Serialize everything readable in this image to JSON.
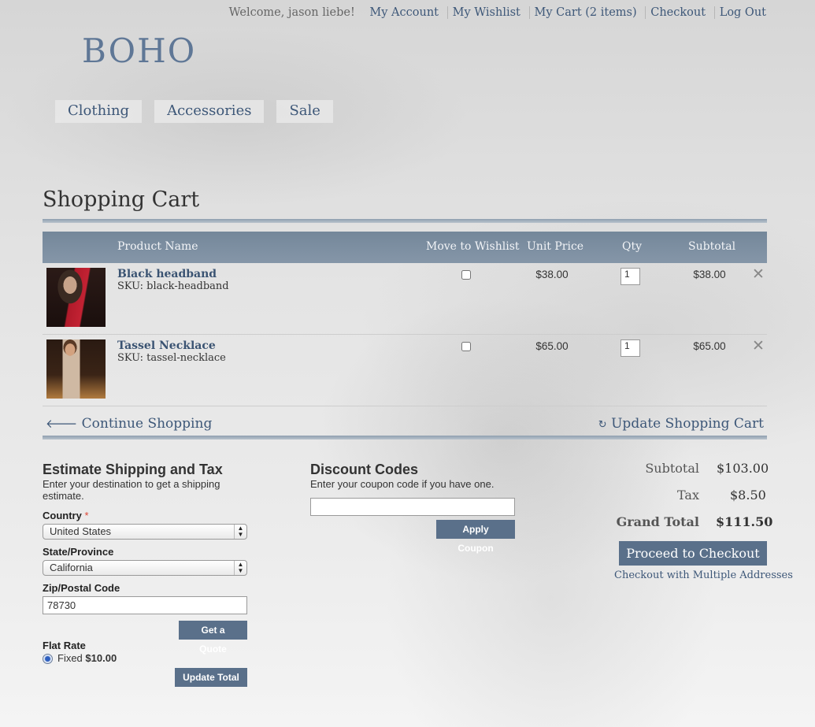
{
  "header": {
    "welcome": "Welcome, jason liebe!",
    "links": [
      "My Account",
      "My Wishlist",
      "My Cart (2 items)",
      "Checkout",
      "Log Out"
    ],
    "logo": "BOHO",
    "nav": [
      "Clothing",
      "Accessories",
      "Sale"
    ]
  },
  "page_title": "Shopping Cart",
  "cart": {
    "columns": {
      "product_name": "Product Name",
      "move_to_wishlist": "Move to Wishlist",
      "unit_price": "Unit Price",
      "qty": "Qty",
      "subtotal": "Subtotal"
    },
    "items": [
      {
        "name": "Black headband",
        "sku": "SKU: black-headband",
        "price": "$38.00",
        "qty": "1",
        "subtotal": "$38.00",
        "wishlist_checked": false
      },
      {
        "name": "Tassel Necklace",
        "sku": "SKU: tassel-necklace",
        "price": "$65.00",
        "qty": "1",
        "subtotal": "$65.00",
        "wishlist_checked": false
      }
    ],
    "continue_label": "Continue Shopping",
    "update_label": "Update Shopping Cart"
  },
  "shipping": {
    "title": "Estimate Shipping and Tax",
    "desc": "Enter your destination to get a shipping estimate.",
    "country_label": "Country",
    "required_mark": "*",
    "country": "United States",
    "state_label": "State/Province",
    "state": "California",
    "zip_label": "Zip/Postal Code",
    "zip": "78730",
    "quote_btn": "Get a Quote",
    "method_title": "Flat Rate",
    "method_label": "Fixed",
    "method_price": "$10.00",
    "update_btn": "Update Total"
  },
  "discount": {
    "title": "Discount Codes",
    "desc": "Enter your coupon code if you have one.",
    "code": "",
    "apply_btn": "Apply Coupon"
  },
  "totals": {
    "subtotal_label": "Subtotal",
    "subtotal": "$103.00",
    "tax_label": "Tax",
    "tax": "$8.50",
    "grand_label": "Grand Total",
    "grand": "$111.50",
    "checkout_btn": "Proceed to Checkout",
    "multi_link": "Checkout with Multiple Addresses"
  }
}
